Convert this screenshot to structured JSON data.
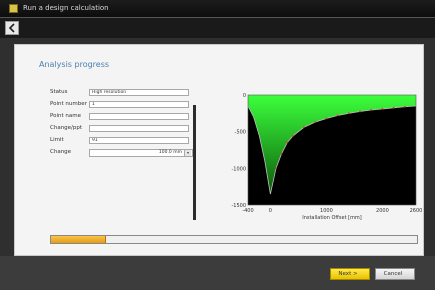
{
  "window": {
    "title": "Run a design calculation"
  },
  "section": {
    "title": "Analysis progress"
  },
  "fields": [
    {
      "label": "Status",
      "value": "High resolution"
    },
    {
      "label": "Point number",
      "value": "1"
    },
    {
      "label": "Point name",
      "value": ""
    },
    {
      "label": "Change/ppt",
      "value": ""
    },
    {
      "label": "Limit",
      "value": "91"
    },
    {
      "label": "Change",
      "value": "100.0 mm"
    }
  ],
  "chart_data": {
    "type": "line",
    "title": "",
    "xlabel": "Installation Offset [mm]",
    "ylabel": "",
    "xlim": [
      -400,
      2600
    ],
    "ylim": [
      -1500,
      0
    ],
    "x_ticks": [
      "-400",
      "0",
      "1000",
      "2000",
      "2600"
    ],
    "y_ticks": [
      "0",
      "-500",
      "-1000",
      "-1500"
    ],
    "colors": {
      "fill": "#29e32a",
      "background": "#000000",
      "points": "#e03030",
      "curve": "#bfbfbf"
    },
    "series": [
      {
        "x": [
          -400,
          -300,
          -200,
          -100,
          0,
          100,
          200,
          300,
          400,
          600,
          800,
          1000,
          1200,
          1400,
          1600,
          1800,
          2000,
          2200,
          2400,
          2600
        ],
        "values": [
          -150,
          -300,
          -550,
          -900,
          -1350,
          -1000,
          -800,
          -650,
          -560,
          -440,
          -370,
          -320,
          -280,
          -250,
          -225,
          -205,
          -190,
          -175,
          -160,
          -150
        ]
      }
    ],
    "points": {
      "x": [
        100,
        200,
        300,
        400,
        600,
        800,
        1000,
        1200,
        1400,
        1600,
        1800,
        2000,
        2200,
        2400
      ],
      "values": [
        -1000,
        -800,
        -650,
        -560,
        -440,
        -370,
        -320,
        -280,
        -250,
        -225,
        -205,
        -190,
        -175,
        -160
      ]
    }
  },
  "progress": {
    "percent": 0.15,
    "color": "#f2b12e"
  },
  "buttons": {
    "next": "Next >",
    "cancel": "Cancel"
  }
}
